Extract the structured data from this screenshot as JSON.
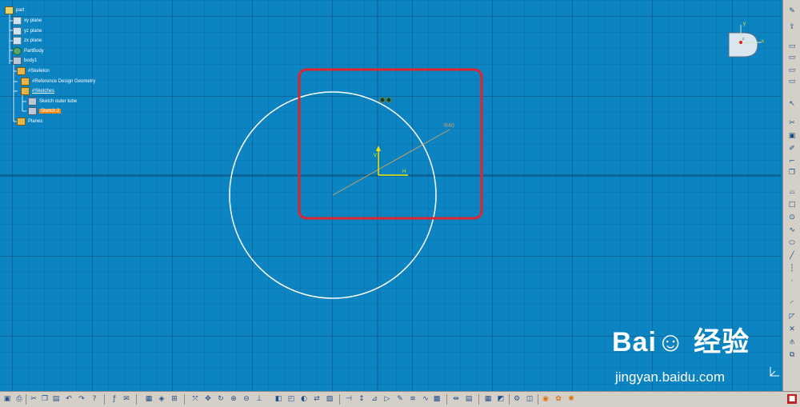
{
  "tree": {
    "part": "part",
    "xy_plane": "xy plane",
    "yz_plane": "yz plane",
    "zx_plane": "zx plane",
    "partbody": "PartBody",
    "body1": "body1",
    "skeleton": "#Skeleton",
    "reference_geometry": "#Reference Design Geometry",
    "sketches": "#Sketches",
    "sketch_outer_tube": "Sketch outer tube",
    "sketch_2": "Sketch.2",
    "planes": "Planes"
  },
  "sketch": {
    "radius_label": "R40",
    "axis_h": "H",
    "axis_v": "V"
  },
  "compass": {
    "x_label": "x",
    "y_label": "y",
    "z_label": "z"
  },
  "watermark": {
    "logo": "Bai☺ 经验",
    "url": "jingyan.baidu.com"
  },
  "colors": {
    "background": "#0d84c2",
    "highlight_box": "#e0242c",
    "circle": "#ffffff",
    "radius_line": "#c8a060",
    "axis": "#f2e600",
    "selection": "#f28a1a"
  },
  "right_toolbar_icons": [
    "sketch-icon",
    "export-icon",
    "view-icon",
    "view-icon",
    "view-icon",
    "view-icon",
    "select-icon",
    "cut-icon",
    "constraint-icon",
    "pencil-icon",
    "profile-icon",
    "copy-icon",
    "profile-icon",
    "rectangle-icon",
    "circle-icon",
    "spline-icon",
    "ellipse-icon",
    "line-icon",
    "axis-icon",
    "point-icon",
    "corner-icon",
    "chamfer-icon",
    "trim-icon",
    "mirror-icon",
    "project-icon"
  ],
  "bottom_toolbar_icons": [
    "save-icon",
    "print-icon",
    "cut-icon",
    "copy-icon",
    "paste-icon",
    "undo-icon",
    "redo-icon",
    "whats-this-icon",
    "formula-icon",
    "comment-icon",
    "grid-icon",
    "render-icon",
    "measure-icon",
    "fit-all-icon",
    "pan-icon",
    "rotate-icon",
    "zoom-in-icon",
    "zoom-out-icon",
    "normal-view-icon",
    "iso-view-icon",
    "multi-view-icon",
    "hide-show-icon",
    "swap-icon",
    "shading-icon",
    "constraint-icon",
    "dimension-icon",
    "auto-constraint-icon",
    "animate-icon",
    "edit-icon",
    "analysis-icon",
    "sketch-solve-icon",
    "grid-snap-icon",
    "construct-icon",
    "geometry-icon",
    "exit-sketch-icon",
    "options-icon",
    "tools-icon",
    "workbench-icon"
  ]
}
